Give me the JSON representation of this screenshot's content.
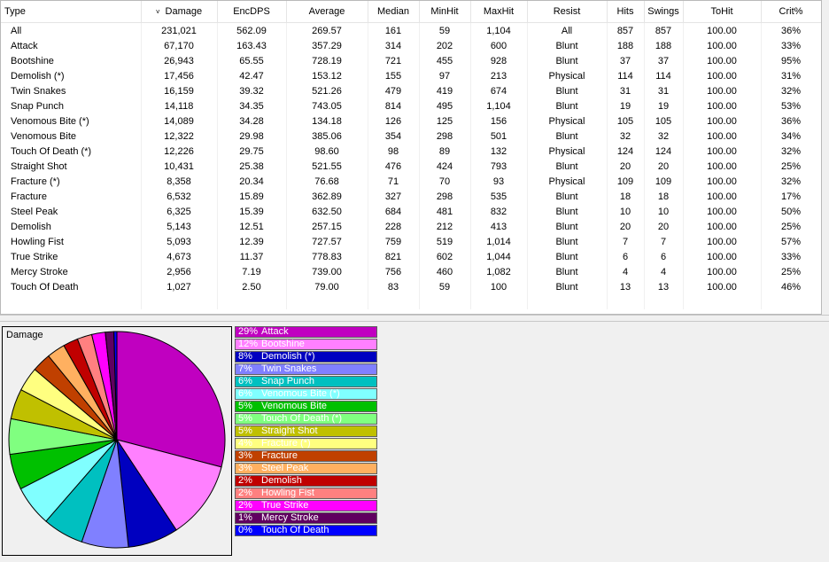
{
  "table": {
    "columns": [
      {
        "label": "Type",
        "width": 158,
        "align": "lft"
      },
      {
        "label": "Damage",
        "width": 86,
        "align": "ctr",
        "sorted": true
      },
      {
        "label": "EncDPS",
        "width": 78,
        "align": "ctr"
      },
      {
        "label": "Average",
        "width": 92,
        "align": "ctr"
      },
      {
        "label": "Median",
        "width": 58,
        "align": "ctr"
      },
      {
        "label": "MinHit",
        "width": 58,
        "align": "ctr"
      },
      {
        "label": "MaxHit",
        "width": 64,
        "align": "ctr"
      },
      {
        "label": "Resist",
        "width": 90,
        "align": "ctr"
      },
      {
        "label": "Hits",
        "width": 42,
        "align": "ctr"
      },
      {
        "label": "Swings",
        "width": 44,
        "align": "ctr"
      },
      {
        "label": "ToHit",
        "width": 88,
        "align": "ctr"
      },
      {
        "label": "Crit%",
        "width": 68,
        "align": "ctr"
      }
    ],
    "sort_indicator": "˅",
    "rows": [
      [
        "All",
        "231,021",
        "562.09",
        "269.57",
        "161",
        "59",
        "1,104",
        "All",
        "857",
        "857",
        "100.00",
        "36%"
      ],
      [
        "Attack",
        "67,170",
        "163.43",
        "357.29",
        "314",
        "202",
        "600",
        "Blunt",
        "188",
        "188",
        "100.00",
        "33%"
      ],
      [
        "Bootshine",
        "26,943",
        "65.55",
        "728.19",
        "721",
        "455",
        "928",
        "Blunt",
        "37",
        "37",
        "100.00",
        "95%"
      ],
      [
        "Demolish (*)",
        "17,456",
        "42.47",
        "153.12",
        "155",
        "97",
        "213",
        "Physical",
        "114",
        "114",
        "100.00",
        "31%"
      ],
      [
        "Twin Snakes",
        "16,159",
        "39.32",
        "521.26",
        "479",
        "419",
        "674",
        "Blunt",
        "31",
        "31",
        "100.00",
        "32%"
      ],
      [
        "Snap Punch",
        "14,118",
        "34.35",
        "743.05",
        "814",
        "495",
        "1,104",
        "Blunt",
        "19",
        "19",
        "100.00",
        "53%"
      ],
      [
        "Venomous Bite (*)",
        "14,089",
        "34.28",
        "134.18",
        "126",
        "125",
        "156",
        "Physical",
        "105",
        "105",
        "100.00",
        "36%"
      ],
      [
        "Venomous Bite",
        "12,322",
        "29.98",
        "385.06",
        "354",
        "298",
        "501",
        "Blunt",
        "32",
        "32",
        "100.00",
        "34%"
      ],
      [
        "Touch Of Death (*)",
        "12,226",
        "29.75",
        "98.60",
        "98",
        "89",
        "132",
        "Physical",
        "124",
        "124",
        "100.00",
        "32%"
      ],
      [
        "Straight Shot",
        "10,431",
        "25.38",
        "521.55",
        "476",
        "424",
        "793",
        "Blunt",
        "20",
        "20",
        "100.00",
        "25%"
      ],
      [
        "Fracture (*)",
        "8,358",
        "20.34",
        "76.68",
        "71",
        "70",
        "93",
        "Physical",
        "109",
        "109",
        "100.00",
        "32%"
      ],
      [
        "Fracture",
        "6,532",
        "15.89",
        "362.89",
        "327",
        "298",
        "535",
        "Blunt",
        "18",
        "18",
        "100.00",
        "17%"
      ],
      [
        "Steel Peak",
        "6,325",
        "15.39",
        "632.50",
        "684",
        "481",
        "832",
        "Blunt",
        "10",
        "10",
        "100.00",
        "50%"
      ],
      [
        "Demolish",
        "5,143",
        "12.51",
        "257.15",
        "228",
        "212",
        "413",
        "Blunt",
        "20",
        "20",
        "100.00",
        "25%"
      ],
      [
        "Howling Fist",
        "5,093",
        "12.39",
        "727.57",
        "759",
        "519",
        "1,014",
        "Blunt",
        "7",
        "7",
        "100.00",
        "57%"
      ],
      [
        "True Strike",
        "4,673",
        "11.37",
        "778.83",
        "821",
        "602",
        "1,044",
        "Blunt",
        "6",
        "6",
        "100.00",
        "33%"
      ],
      [
        "Mercy Stroke",
        "2,956",
        "7.19",
        "739.00",
        "756",
        "460",
        "1,082",
        "Blunt",
        "4",
        "4",
        "100.00",
        "25%"
      ],
      [
        "Touch Of Death",
        "1,027",
        "2.50",
        "79.00",
        "83",
        "59",
        "100",
        "Blunt",
        "13",
        "13",
        "100.00",
        "46%"
      ]
    ]
  },
  "chart": {
    "label": "Damage",
    "slices": [
      {
        "name": "Attack",
        "pct_label": "29%",
        "value": 67170,
        "color": "#c000c0"
      },
      {
        "name": "Bootshine",
        "pct_label": "12%",
        "value": 26943,
        "color": "#ff80ff"
      },
      {
        "name": "Demolish (*)",
        "pct_label": "8%",
        "value": 17456,
        "color": "#0000c0"
      },
      {
        "name": "Twin Snakes",
        "pct_label": "7%",
        "value": 16159,
        "color": "#8080ff"
      },
      {
        "name": "Snap Punch",
        "pct_label": "6%",
        "value": 14118,
        "color": "#00c0c0"
      },
      {
        "name": "Venomous Bite (*)",
        "pct_label": "6%",
        "value": 14089,
        "color": "#80ffff"
      },
      {
        "name": "Venomous Bite",
        "pct_label": "5%",
        "value": 12322,
        "color": "#00c000"
      },
      {
        "name": "Touch Of Death (*)",
        "pct_label": "5%",
        "value": 12226,
        "color": "#80ff80"
      },
      {
        "name": "Straight Shot",
        "pct_label": "5%",
        "value": 10431,
        "color": "#c0c000"
      },
      {
        "name": "Fracture (*)",
        "pct_label": "4%",
        "value": 8358,
        "color": "#ffff80"
      },
      {
        "name": "Fracture",
        "pct_label": "3%",
        "value": 6532,
        "color": "#c04000"
      },
      {
        "name": "Steel Peak",
        "pct_label": "3%",
        "value": 6325,
        "color": "#ffb060"
      },
      {
        "name": "Demolish",
        "pct_label": "2%",
        "value": 5143,
        "color": "#c00000"
      },
      {
        "name": "Howling Fist",
        "pct_label": "2%",
        "value": 5093,
        "color": "#ff8080"
      },
      {
        "name": "True Strike",
        "pct_label": "2%",
        "value": 4673,
        "color": "#ff00ff"
      },
      {
        "name": "Mercy Stroke",
        "pct_label": "1%",
        "value": 2956,
        "color": "#600060"
      },
      {
        "name": "Touch Of Death",
        "pct_label": "0%",
        "value": 1027,
        "color": "#0000ff"
      }
    ]
  }
}
